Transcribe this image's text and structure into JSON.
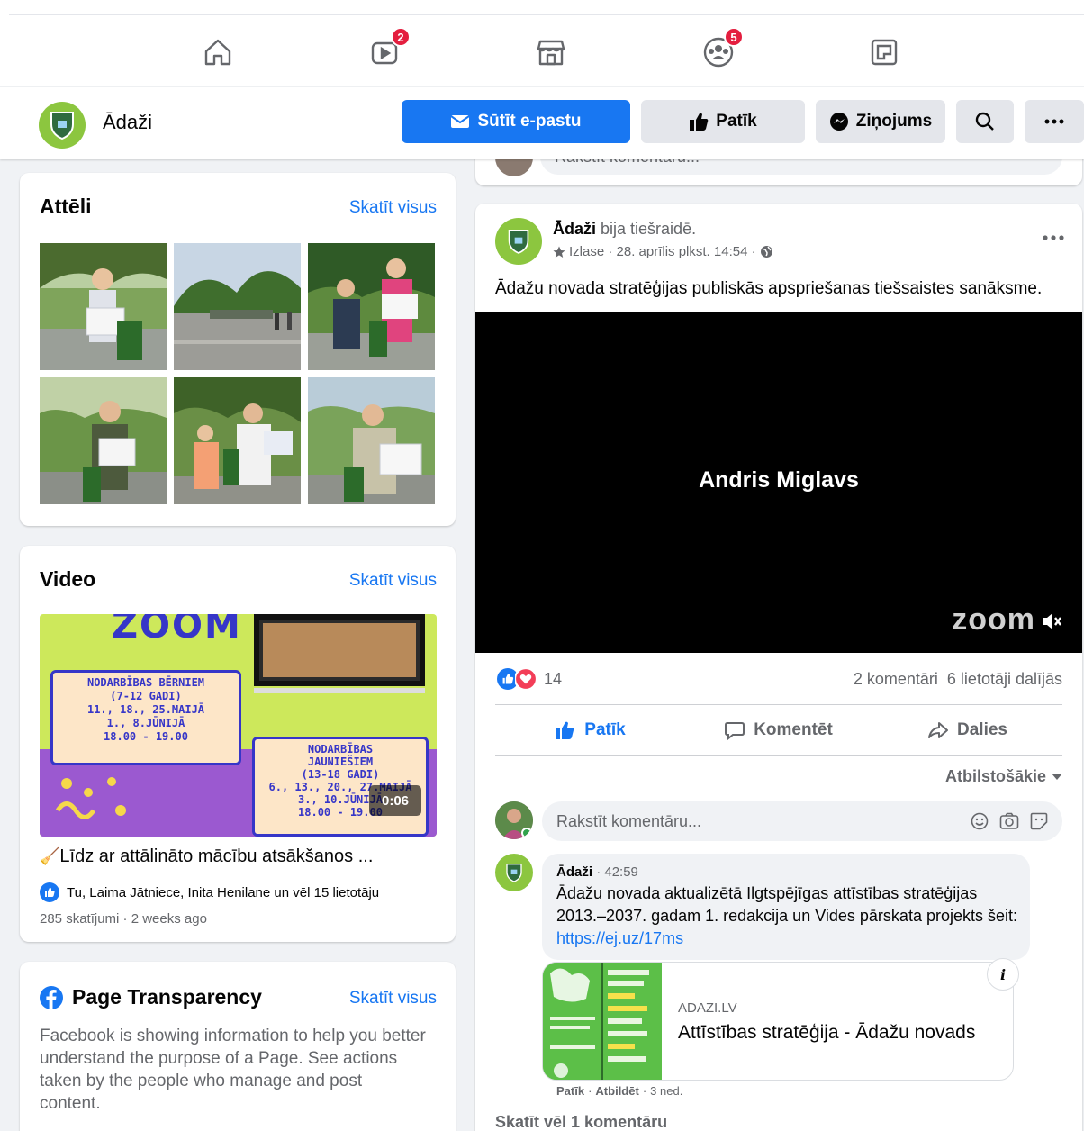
{
  "nav": {
    "watch_badge": "2",
    "groups_badge": "5",
    "icons": [
      "home-icon",
      "watch-icon",
      "marketplace-icon",
      "groups-icon",
      "gaming-icon"
    ]
  },
  "page": {
    "name": "Ādaži",
    "buttons": {
      "email": "Sūtīt e-pastu",
      "like": "Patīk",
      "message": "Ziņojums"
    }
  },
  "photos": {
    "title": "Attēli",
    "see_all": "Skatīt visus"
  },
  "video": {
    "title": "Video",
    "see_all": "Skatīt visus",
    "duration": "0:06",
    "caption": "Līdz ar attālināto mācību atsākšanos ...",
    "likers": "Tu, Laima Jātniece, Inita Henilane un vēl 15 lietotāju",
    "meta": "285 skatījumi · 2 weeks ago",
    "thumb_text": {
      "zoom": "ZOOM",
      "kids": [
        "NODARBĪBAS BĒRNIEM",
        "(7-12 GADI)",
        "11., 18., 25.MAIJĀ",
        "1., 8.JŪNIJĀ",
        "18.00 - 19.00"
      ],
      "teens": [
        "NODARBĪBAS",
        "JAUNIEŠIEM",
        "(13-18 GADI)",
        "6., 13., 20., 27.MAIJĀ",
        "3., 10.JŪNIJĀ",
        "18.00 - 19.00"
      ]
    }
  },
  "transparency": {
    "title": "Page Transparency",
    "see_all": "Skatīt visus",
    "text": "Facebook is showing information to help you better understand the purpose of a Page. See actions taken by the people who manage and post content."
  },
  "prev_comment": {
    "placeholder": "Rakstīt komentāru..."
  },
  "post": {
    "author": "Ādaži",
    "action": " bija tiešraidē.",
    "meta": "Izlase · 28. aprīlis plkst. 14:54 ·",
    "text": "Ādažu novada stratēģijas publiskās apspriešanas tiešsaistes sanāksme.",
    "video_name": "Andris Miglavs",
    "video_logo": "zoom",
    "reactions_count": "14",
    "comments_count": "2 komentāri",
    "shares_count": "6 lietotāji dalījās",
    "actions": {
      "like": "Patīk",
      "comment": "Komentēt",
      "share": "Dalies"
    },
    "sort": "Atbilstošākie",
    "comment_placeholder": "Rakstīt komentāru...",
    "comment": {
      "author": "Ādaži",
      "time": "42:59",
      "text": "Ādažu novada aktualizētā Ilgtspējīgas attīstības stratēģijas 2013.–2037. gadam 1. redakcija un Vides pārskata projekts šeit: ",
      "link": "https://ej.uz/17ms",
      "preview_domain": "ADAZI.LV",
      "preview_title": "Attīstības stratēģija - Ādažu novads",
      "like": "Patīk",
      "reply": "Atbildēt",
      "age": "3 ned."
    },
    "more_comments": "Skatīt vēl 1 komentāru"
  }
}
